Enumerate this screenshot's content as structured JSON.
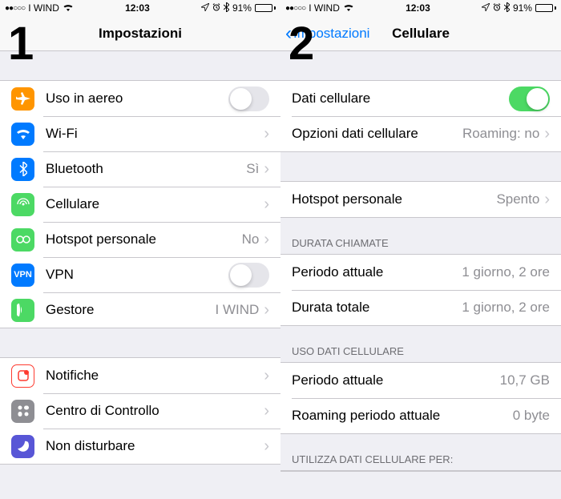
{
  "status": {
    "carrier": "I WIND",
    "time": "12:03",
    "battery": "91%"
  },
  "screen1": {
    "badge": "1",
    "title": "Impostazioni",
    "rows": {
      "airplane": "Uso in aereo",
      "wifi": "Wi-Fi",
      "bluetooth": "Bluetooth",
      "bluetooth_value": "Sì",
      "cellular": "Cellulare",
      "hotspot": "Hotspot personale",
      "hotspot_value": "No",
      "vpn": "VPN",
      "vpn_badge": "VPN",
      "carrier": "Gestore",
      "carrier_value": "I WIND",
      "notifications": "Notifiche",
      "controlcenter": "Centro di Controllo",
      "dnd": "Non disturbare"
    }
  },
  "screen2": {
    "badge": "2",
    "back": "Impostazioni",
    "title": "Cellulare",
    "rows": {
      "cellular_data": "Dati cellulare",
      "options": "Opzioni dati cellulare",
      "options_value": "Roaming: no",
      "hotspot": "Hotspot personale",
      "hotspot_value": "Spento"
    },
    "sections": {
      "calls": "DURATA CHIAMATE",
      "current_period": "Periodo attuale",
      "current_period_value": "1 giorno, 2 ore",
      "lifetime": "Durata totale",
      "lifetime_value": "1 giorno, 2 ore",
      "data_usage": "USO DATI CELLULARE",
      "data_current": "Periodo attuale",
      "data_current_value": "10,7 GB",
      "roaming_current": "Roaming periodo attuale",
      "roaming_current_value": "0 byte",
      "use_for": "UTILIZZA DATI CELLULARE PER:"
    }
  }
}
